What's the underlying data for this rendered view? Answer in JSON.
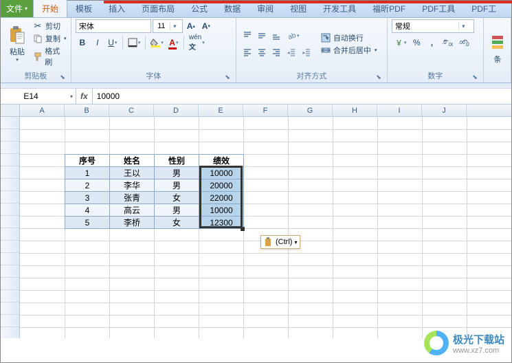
{
  "tabs": {
    "file": "文件",
    "items": [
      "开始",
      "模板",
      "插入",
      "页面布局",
      "公式",
      "数据",
      "审阅",
      "视图",
      "开发工具",
      "福昕PDF",
      "PDF工具",
      "PDF工"
    ],
    "active_index": 0
  },
  "clipboard": {
    "paste": "粘贴",
    "cut": "剪切",
    "copy": "复制",
    "fmt": "格式刷",
    "label": "剪贴板"
  },
  "font": {
    "name": "宋体",
    "size": "11",
    "label": "字体"
  },
  "align": {
    "wrap": "自动换行",
    "merge": "合并后居中",
    "label": "对齐方式"
  },
  "number": {
    "format": "常规",
    "label": "数字"
  },
  "styles_label": "条",
  "namebox": "E14",
  "formula": "10000",
  "columns": [
    "A",
    "B",
    "C",
    "D",
    "E",
    "F",
    "G",
    "H",
    "I",
    "J"
  ],
  "table": {
    "headers": [
      "序号",
      "姓名",
      "性别",
      "绩效"
    ],
    "rows": [
      [
        "1",
        "王以",
        "男",
        "10000"
      ],
      [
        "2",
        "李华",
        "男",
        "20000"
      ],
      [
        "3",
        "张青",
        "女",
        "22000"
      ],
      [
        "4",
        "高云",
        "男",
        "10000"
      ],
      [
        "5",
        "李桥",
        "女",
        "12300"
      ]
    ]
  },
  "paste_tag": "(Ctrl)",
  "watermark": {
    "name": "极光下载站",
    "url": "www.xz7.com"
  },
  "chart_data": {
    "type": "table",
    "title": "",
    "columns": [
      "序号",
      "姓名",
      "性别",
      "绩效"
    ],
    "rows": [
      {
        "序号": 1,
        "姓名": "王以",
        "性别": "男",
        "绩效": 10000
      },
      {
        "序号": 2,
        "姓名": "李华",
        "性别": "男",
        "绩效": 20000
      },
      {
        "序号": 3,
        "姓名": "张青",
        "性别": "女",
        "绩效": 22000
      },
      {
        "序号": 4,
        "姓名": "高云",
        "性别": "男",
        "绩效": 10000
      },
      {
        "序号": 5,
        "姓名": "李桥",
        "性别": "女",
        "绩效": 12300
      }
    ]
  }
}
